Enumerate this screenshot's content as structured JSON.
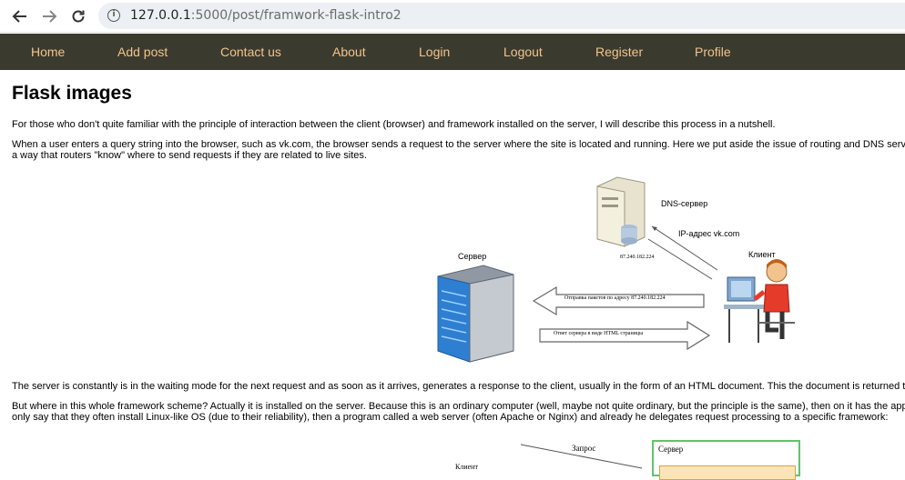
{
  "browser": {
    "url_host": "127.0.0.1",
    "url_rest": ":5000/post/framwork-flask-intro2",
    "back_icon": "arrow-left-icon",
    "forward_icon": "arrow-right-icon",
    "reload_icon": "reload-icon",
    "info_icon": "info-icon"
  },
  "nav": {
    "items": [
      {
        "label": "Home"
      },
      {
        "label": "Add post"
      },
      {
        "label": "Contact us"
      },
      {
        "label": "About"
      },
      {
        "label": "Login"
      },
      {
        "label": "Logout"
      },
      {
        "label": "Register"
      },
      {
        "label": "Profile"
      }
    ]
  },
  "article": {
    "title": "Flask images",
    "p1": "For those who don't quite familiar with the principle of interaction between the client (browser) and framework installed on the server, I will describe this process in a nutshell.",
    "p2_line1": "When a user enters a query string into the browser, such as vk.com, the browser sends a request to the server where the site is located and running. Here we put aside the issue of routing and DNS servers, it",
    "p2_line2": "a way that routers \"know\" where to send requests if they are related to live sites.",
    "p3": "The server is constantly is in the waiting mode for the next request and as soon as it arrives, generates a response to the client, usually in the form of an HTML document. This the document is returned to the b",
    "p4_line1": "But where in this whole framework scheme? Actually it is installed on the server. Because this is an ordinary computer (well, maybe not quite ordinary, but the principle is the same), then on it has the appropria",
    "p4_line2": "only say that they often install Linux-like OS (due to their reliability), then a program called a web server (often Apache or Nginx) and already he delegates request processing to a specific framework:"
  },
  "diagram1": {
    "dns_label": "DNS-сервер",
    "ip_label": "IP-адрес vk.com",
    "client_label": "Клиент",
    "server_label": "Сервер",
    "ip_value": "87.240.182.224",
    "arrow_left_text": "Отправка пакетов по адресу 87.240.182.224",
    "arrow_right_text": "Ответ сервера в виде HTML страницы"
  },
  "diagram2": {
    "request_label": "Запрос",
    "server_label": "Сервер",
    "client_label": "Клиент"
  },
  "colors": {
    "nav_bg": "#3b3a2e",
    "nav_link": "#f3c489"
  }
}
